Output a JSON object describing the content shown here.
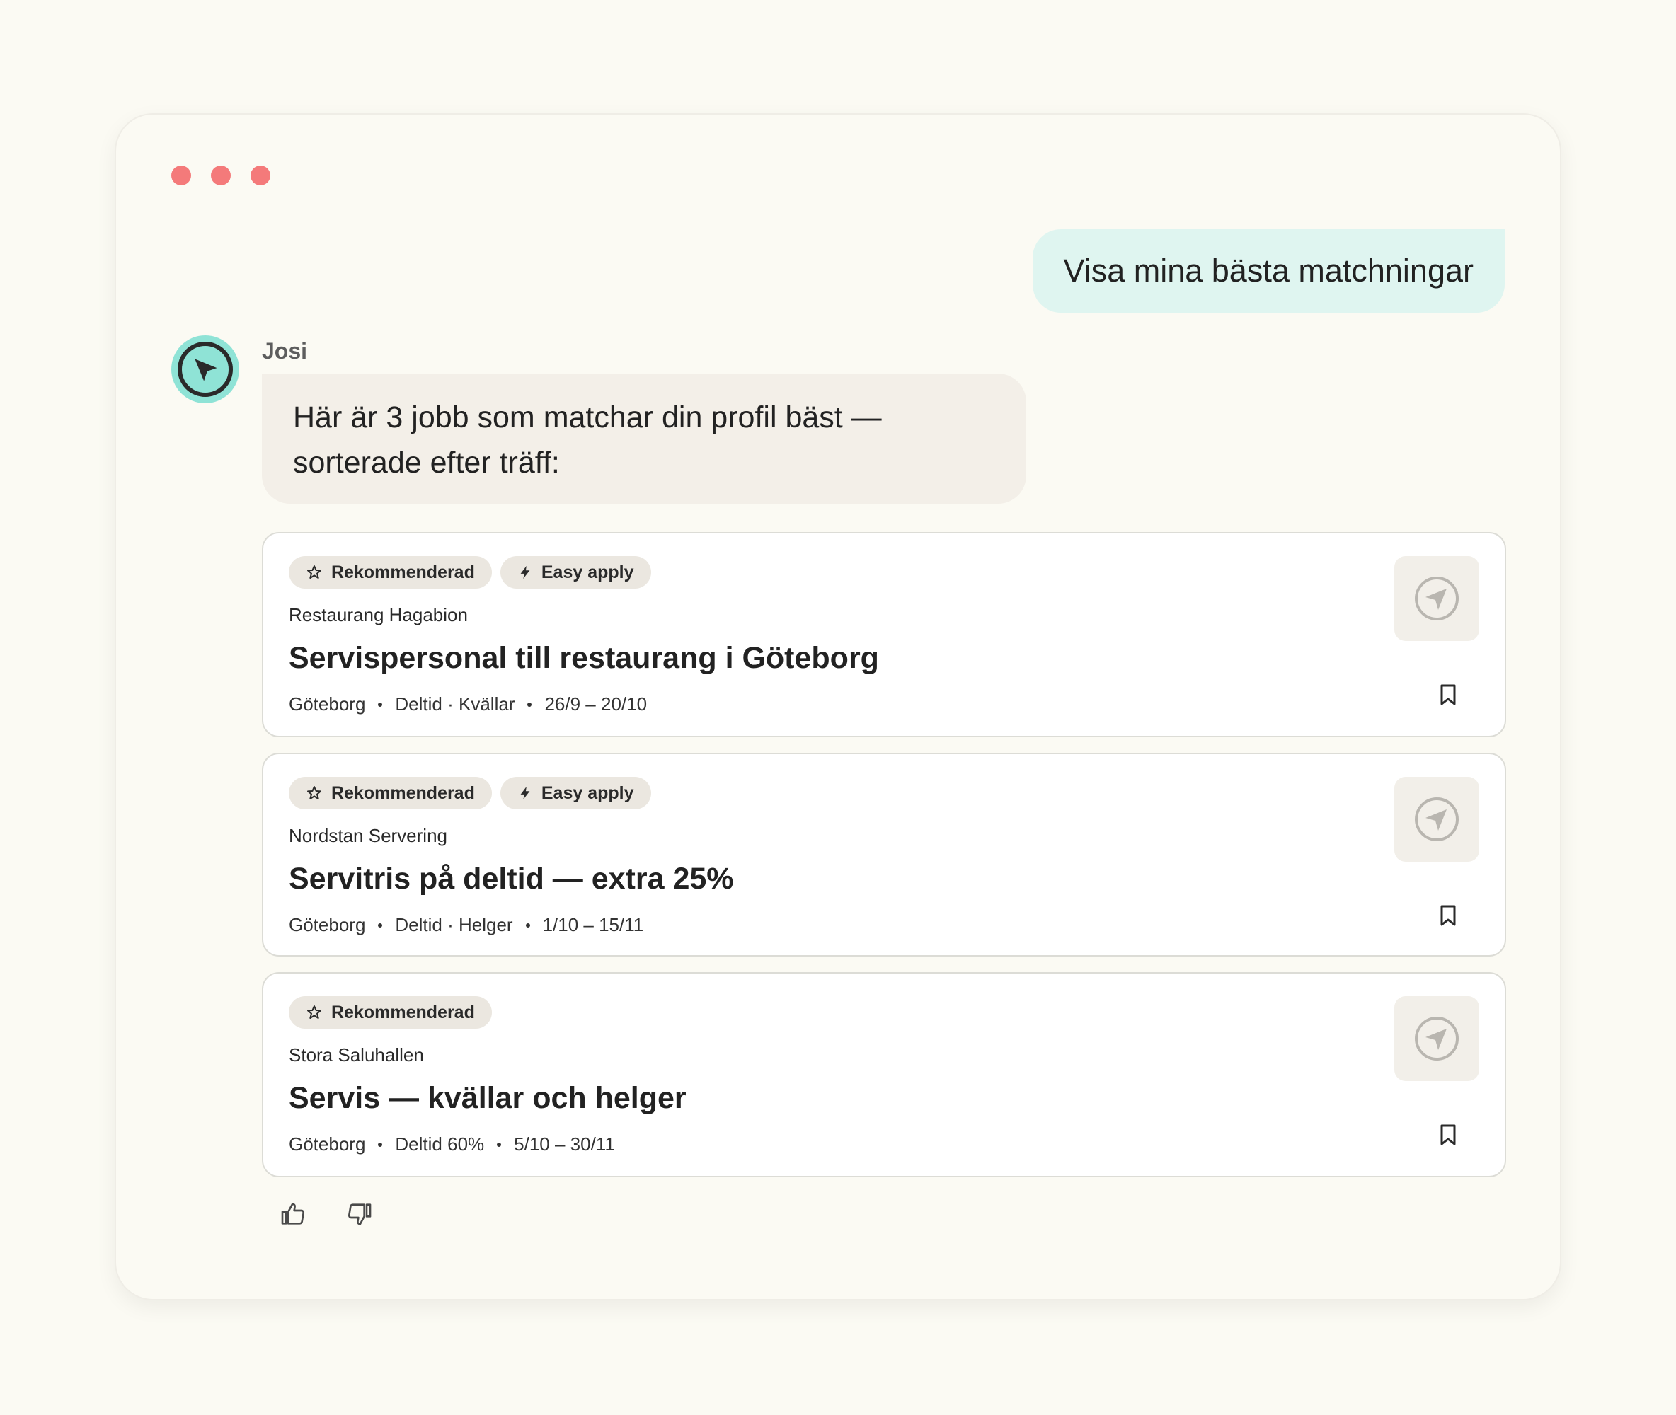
{
  "window": {
    "dot_color": "#f47a7a"
  },
  "chat": {
    "user_message": "Visa mina bästa matchningar",
    "bot_name": "Josi",
    "bot_message_line1": "Här är 3 jobb som matchar din profil bäst —",
    "bot_message_line2": "sorterade efter träff:"
  },
  "jobs": [
    {
      "badges": [
        "Rekommenderad",
        "Easy apply"
      ],
      "company": "Restaurang Hagabion",
      "title": "Servispersonal till restaurang i Göteborg",
      "location": "Göteborg",
      "type": "Deltid · Kvällar",
      "dates": "26/9 – 20/10"
    },
    {
      "badges": [
        "Rekommenderad",
        "Easy apply"
      ],
      "company": "Nordstan Servering",
      "title": "Servitris på deltid — extra 25%",
      "location": "Göteborg",
      "type": "Deltid · Helger",
      "dates": "1/10 – 15/11"
    },
    {
      "badges": [
        "Rekommenderad"
      ],
      "company": "Stora Saluhallen",
      "title": "Servis — kvällar och helger",
      "location": "Göteborg",
      "type": "Deltid 60%",
      "dates": "5/10 – 30/11"
    }
  ],
  "colors": {
    "user_bubble": "#dff5f0",
    "bot_bubble": "#f3efe8",
    "avatar": "#8fe3d6",
    "badge": "#ebe7e0"
  },
  "icons": {
    "badge_recommended": "star-icon",
    "badge_easy_apply": "lightning-icon",
    "company_logo": "compass-icon",
    "save": "bookmark-icon",
    "feedback_up": "thumbs-up-icon",
    "feedback_down": "thumbs-down-icon",
    "avatar": "compass-icon"
  }
}
